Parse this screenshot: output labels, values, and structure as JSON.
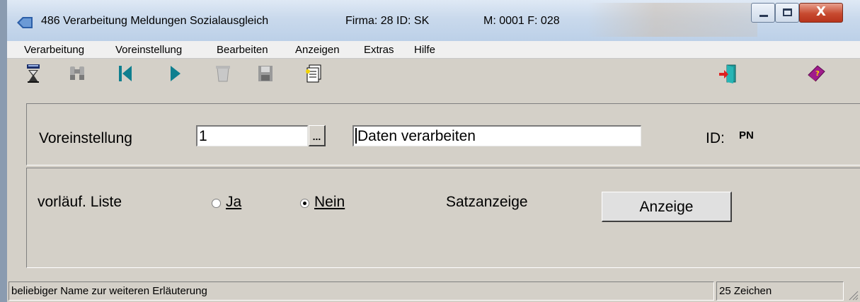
{
  "window": {
    "title": "486 Verarbeitung Meldungen Sozialausgleich",
    "firma": "Firma: 28  ID: SK",
    "mandant": "M: 0001 F: 028",
    "close_glyph": "X"
  },
  "menu": [
    "Verarbeitung",
    "Voreinstellung",
    "Bearbeiten",
    "Anzeigen",
    "Extras",
    "Hilfe"
  ],
  "toolbar": {
    "icons": [
      "run-hourglass-icon",
      "binoculars-icon",
      "first-record-icon",
      "next-record-icon",
      "trash-icon",
      "save-disk-icon",
      "print-settings-icon",
      "exit-door-icon",
      "help-book-icon"
    ]
  },
  "preset": {
    "label": "Voreinstellung",
    "number_value": "1",
    "browse_label": "...",
    "name_value": "Daten verarbeiten",
    "id_label": "ID:",
    "id_value": "PN"
  },
  "options": {
    "list_label": "vorläuf. Liste",
    "radio_ja": "Ja",
    "radio_nein": "Nein",
    "selected": "Nein",
    "satz_label": "Satzanzeige",
    "anzeige_button": "Anzeige"
  },
  "status": {
    "hint": "beliebiger Name zur weiteren Erläuterung",
    "chars": "25 Zeichen"
  }
}
